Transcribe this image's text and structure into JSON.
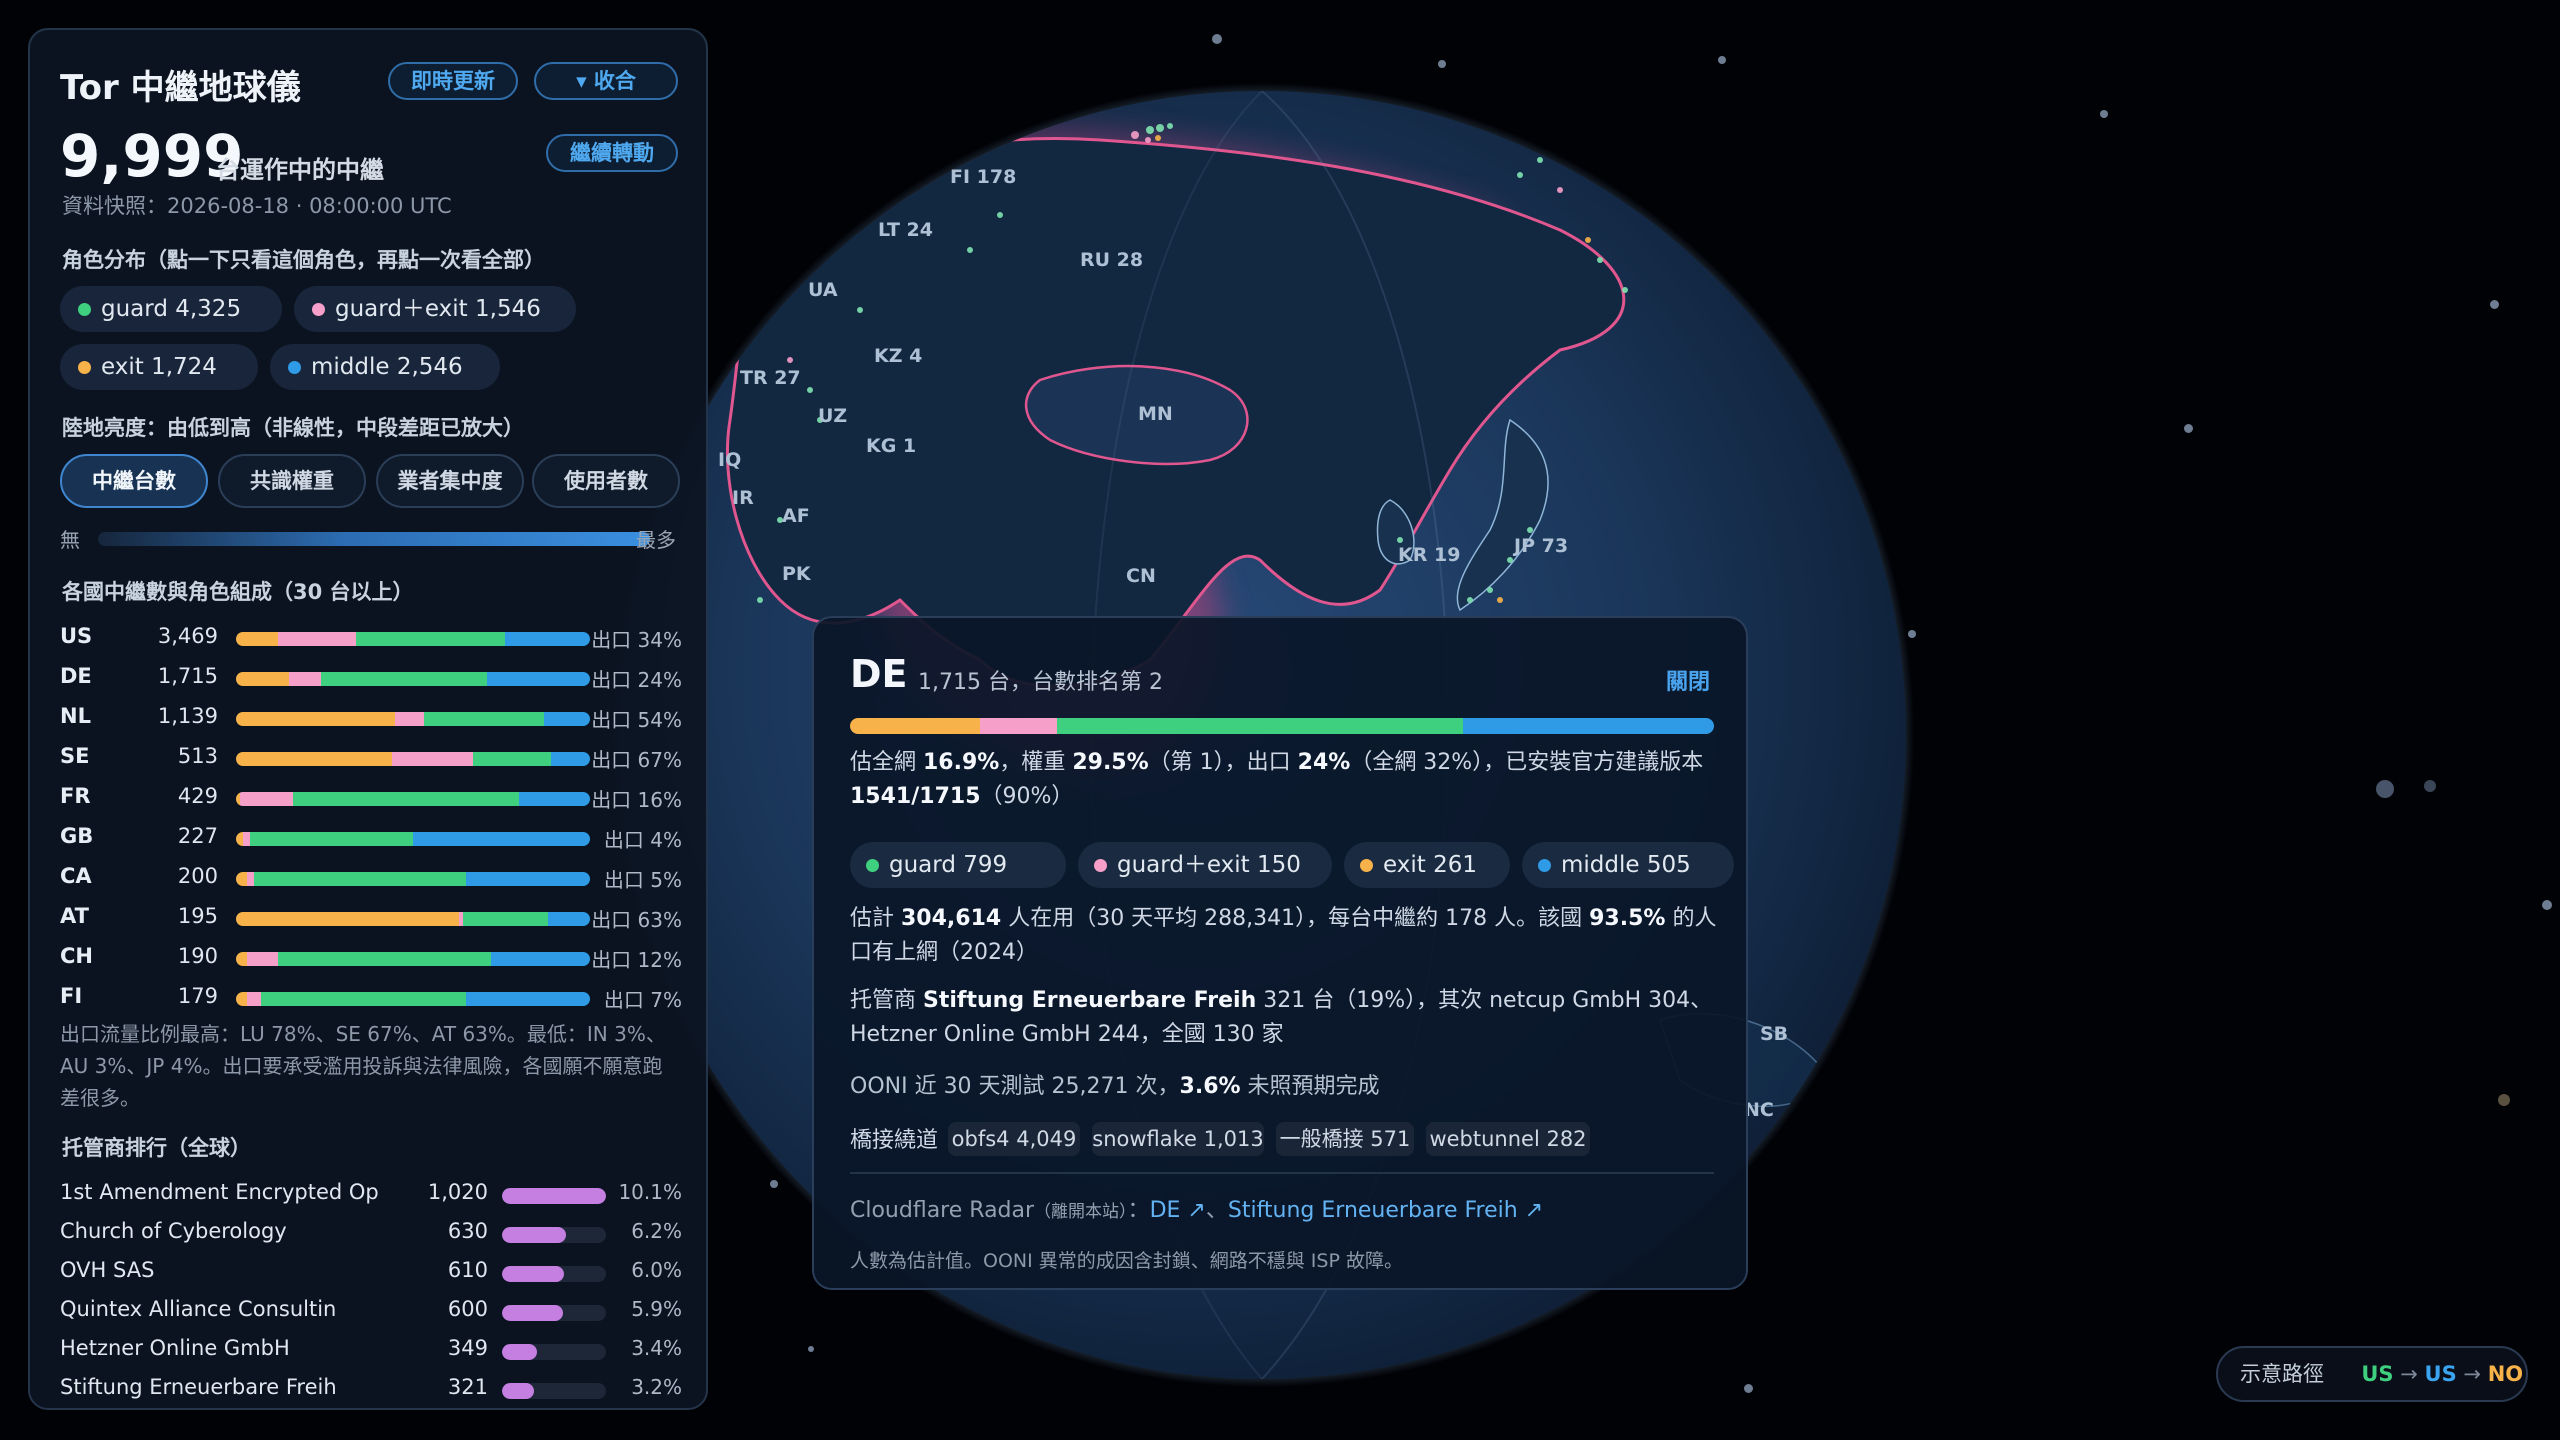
{
  "panel": {
    "title": "Tor 中繼地球儀",
    "refresh_label": "即時更新",
    "collapse_label": "▾ 收合",
    "relay_count": "9,999",
    "relay_caption": "台運作中的中繼",
    "rotate_label": "繼續轉動",
    "snapshot": "資料快照：2026-08-18 · 08:00:00 UTC",
    "roles_title": "角色分布（點一下只看這個角色，再點一次看全部）",
    "roles": [
      {
        "label": "guard 4,325",
        "color": "#3ecf7f"
      },
      {
        "label": "guard＋exit 1,546",
        "color": "#f59fc9"
      },
      {
        "label": "exit 1,724",
        "color": "#f7b24a"
      },
      {
        "label": "middle 2,546",
        "color": "#2f9ae6"
      }
    ],
    "brightness_title": "陸地亮度：由低到高（非線性，中段差距已放大）",
    "modes": [
      "中繼台數",
      "共識權重",
      "業者集中度",
      "使用者數"
    ],
    "active_mode": "中繼台數",
    "scale_min": "無",
    "scale_max": "最多",
    "countries_title": "各國中繼數與角色組成（30 台以上）",
    "countries": [
      {
        "code": "US",
        "count": "3,469",
        "exit": "出口 34%",
        "mix": [
          0.12,
          0.22,
          0.42,
          0.24
        ]
      },
      {
        "code": "DE",
        "count": "1,715",
        "exit": "出口 24%",
        "mix": [
          0.15,
          0.09,
          0.47,
          0.29
        ]
      },
      {
        "code": "NL",
        "count": "1,139",
        "exit": "出口 54%",
        "mix": [
          0.45,
          0.08,
          0.34,
          0.13
        ]
      },
      {
        "code": "SE",
        "count": "513",
        "exit": "出口 67%",
        "mix": [
          0.44,
          0.23,
          0.22,
          0.11
        ]
      },
      {
        "code": "FR",
        "count": "429",
        "exit": "出口 16%",
        "mix": [
          0.01,
          0.15,
          0.64,
          0.2
        ]
      },
      {
        "code": "GB",
        "count": "227",
        "exit": "出口 4%",
        "mix": [
          0.02,
          0.02,
          0.46,
          0.5
        ]
      },
      {
        "code": "CA",
        "count": "200",
        "exit": "出口 5%",
        "mix": [
          0.03,
          0.02,
          0.6,
          0.35
        ]
      },
      {
        "code": "AT",
        "count": "195",
        "exit": "出口 63%",
        "mix": [
          0.63,
          0.01,
          0.24,
          0.12
        ]
      },
      {
        "code": "CH",
        "count": "190",
        "exit": "出口 12%",
        "mix": [
          0.03,
          0.09,
          0.6,
          0.28
        ]
      },
      {
        "code": "FI",
        "count": "179",
        "exit": "出口 7%",
        "mix": [
          0.03,
          0.04,
          0.58,
          0.35
        ]
      }
    ],
    "exit_note": "出口流量比例最高：LU 78%、SE 67%、AT 63%。最低：IN 3%、AU 3%、JP 4%。出口要承受濫用投訴與法律風險，各國願不願意跑差很多。",
    "hosts_title": "托管商排行（全球）",
    "hosts": [
      {
        "name": "1st Amendment Encrypted Op",
        "count": "1,020",
        "share": "10.1%",
        "fill": 1.0
      },
      {
        "name": "Church of Cyberology",
        "count": "630",
        "share": "6.2%",
        "fill": 0.62
      },
      {
        "name": "OVH SAS",
        "count": "610",
        "share": "6.0%",
        "fill": 0.6
      },
      {
        "name": "Quintex Alliance Consultin",
        "count": "600",
        "share": "5.9%",
        "fill": 0.59
      },
      {
        "name": "Hetzner Online GmbH",
        "count": "349",
        "share": "3.4%",
        "fill": 0.34
      },
      {
        "name": "Stiftung Erneuerbare Freih",
        "count": "321",
        "share": "3.2%",
        "fill": 0.31
      }
    ]
  },
  "globe": {
    "labels": [
      "FI 178",
      "LT 24",
      "RU 28",
      "UA",
      "KZ 4",
      "TR 27",
      "UZ",
      "KG 1",
      "MN",
      "IQ",
      "IR",
      "AF",
      "PK",
      "CN",
      "KR 19",
      "JP 73",
      "SB",
      "NC"
    ]
  },
  "popup": {
    "country": "DE",
    "subtitle": "1,715 台，台數排名第 2",
    "close_label": "關閉",
    "mix": [
      0.15,
      0.09,
      0.47,
      0.29
    ],
    "stats_a": "估全網 ",
    "stats_share": "16.9%",
    "stats_b": "，權重 ",
    "stats_weight": "29.5%",
    "stats_c": "（第 1），出口 ",
    "stats_exit": "24%",
    "stats_d": "（全網 32%），已安裝官方建議版本",
    "stats_version": "1541/1715",
    "stats_e": "（90%）",
    "roles": [
      {
        "label": "guard 799",
        "color": "#3ecf7f"
      },
      {
        "label": "guard＋exit 150",
        "color": "#f59fc9"
      },
      {
        "label": "exit 261",
        "color": "#f7b24a"
      },
      {
        "label": "middle 505",
        "color": "#2f9ae6"
      }
    ],
    "users_a": "估計 ",
    "users_num": "304,614",
    "users_b": " 人在用（30 天平均 288,341），每台中繼約 178 人。該國 ",
    "users_pct": "93.5%",
    "users_c": " 的人口有上網（2024）",
    "host_a": "托管商 ",
    "host_name": "Stiftung Erneuerbare Freih",
    "host_b": " 321 台（19%），其次 netcup GmbH 304、Hetzner Online GmbH 244，全國 130 家",
    "ooni_a": "OONI 近 30 天測試 25,271 次，",
    "ooni_pct": "3.6%",
    "ooni_b": " 未照預期完成",
    "bridges_label": "橋接繞道",
    "bridges": [
      "obfs4 4,049",
      "snowflake 1,013",
      "一般橋接 571",
      "webtunnel 282"
    ],
    "radar_label": "Cloudflare Radar",
    "radar_note": "（離開本站）",
    "radar_colon": "：",
    "radar_link1": "DE ↗",
    "radar_sep": "、",
    "radar_link2": "Stiftung Erneuerbare Freih ↗",
    "footnote": "人數為估計值。OONI 異常的成因含封鎖、網路不穩與 ISP 故障。"
  },
  "route": {
    "label": "示意路徑",
    "hops": [
      "US",
      "US",
      "NO"
    ],
    "arrow": "→",
    "colors": [
      "#3ecf7f",
      "#3aa4f0",
      "#f7b24a"
    ]
  },
  "colors": {
    "exit": "#f7b24a",
    "guard_exit": "#f59fc9",
    "guard": "#3ecf7f",
    "middle": "#2f9ae6",
    "accent": "#4aa3ee"
  }
}
